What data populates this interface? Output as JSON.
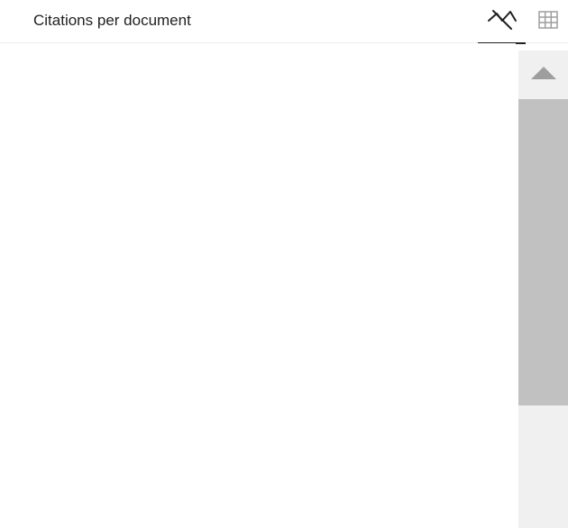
{
  "header": {
    "title": "Citations per document"
  },
  "view_toggle": {
    "chart_icon": "line-chart-icon",
    "table_icon": "table-grid-icon",
    "selected": "chart"
  },
  "scrollbar": {
    "up_icon": "triangle-up-icon"
  },
  "colors": {
    "text": "#212121",
    "tab_underline": "#212121",
    "table_icon": "#9e9e9e",
    "scrollbar_track": "#f0f0f0",
    "scrollbar_thumb": "#c1c1c1",
    "scroll_arrow": "#9e9e9e"
  }
}
